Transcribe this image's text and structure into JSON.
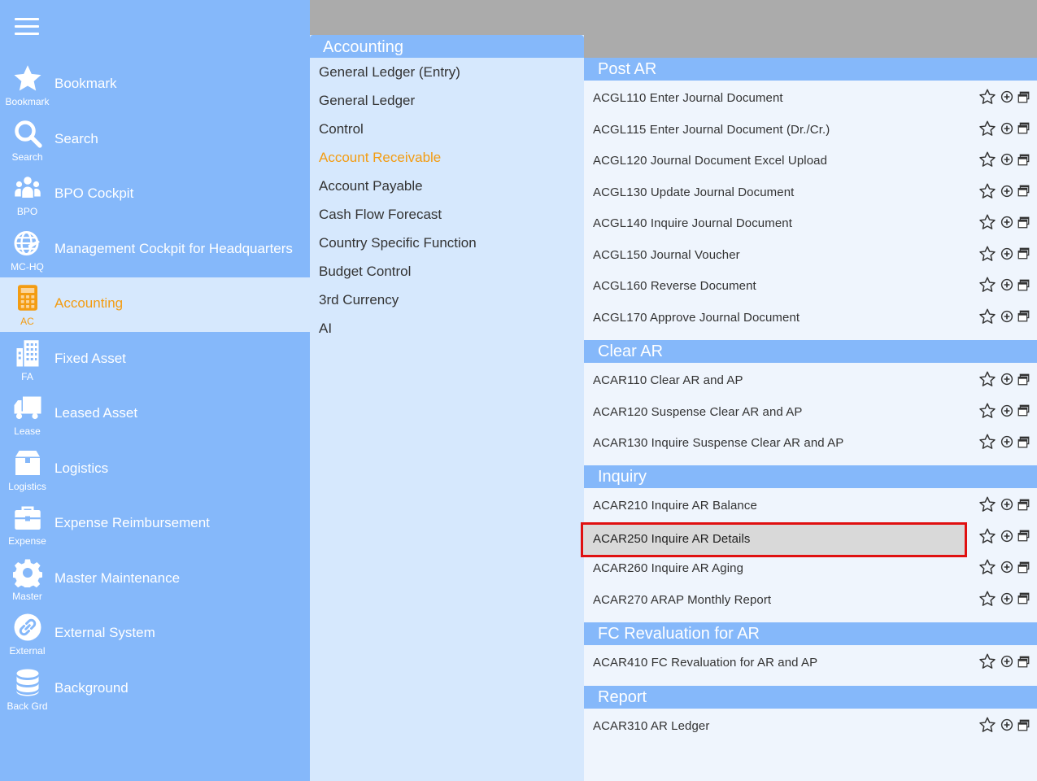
{
  "colors": {
    "sidebar": "#85b8fa",
    "active_bg": "#d6e8fd",
    "active_text": "#f39c12",
    "panel_bg": "#eff5fd",
    "topbar": "#ababab",
    "highlight_border": "#e01010"
  },
  "sidebar": {
    "menu_icon": "hamburger-icon",
    "items": [
      {
        "label": "Bookmark",
        "short": "Bookmark",
        "icon": "star-icon"
      },
      {
        "label": "Search",
        "short": "Search",
        "icon": "search-icon"
      },
      {
        "label": "BPO Cockpit",
        "short": "BPO",
        "icon": "users-icon"
      },
      {
        "label": "Management Cockpit for Headquarters",
        "short": "MC-HQ",
        "icon": "globe-plane-icon"
      },
      {
        "label": "Accounting",
        "short": "AC",
        "icon": "calculator-icon",
        "active": true
      },
      {
        "label": "Fixed Asset",
        "short": "FA",
        "icon": "building-icon"
      },
      {
        "label": "Leased Asset",
        "short": "Lease",
        "icon": "truck-icon"
      },
      {
        "label": "Logistics",
        "short": "Logistics",
        "icon": "box-icon"
      },
      {
        "label": "Expense Reimbursement",
        "short": "Expense",
        "icon": "briefcase-icon"
      },
      {
        "label": "Master Maintenance",
        "short": "Master",
        "icon": "gear-icon"
      },
      {
        "label": "External System",
        "short": "External",
        "icon": "link-icon"
      },
      {
        "label": "Background",
        "short": "Back Grd",
        "icon": "database-icon"
      }
    ]
  },
  "middle": {
    "title": "Accounting",
    "items": [
      {
        "label": "General Ledger (Entry)"
      },
      {
        "label": "General Ledger"
      },
      {
        "label": "Control"
      },
      {
        "label": "Account Receivable",
        "active": true
      },
      {
        "label": "Account Payable"
      },
      {
        "label": "Cash Flow Forecast"
      },
      {
        "label": "Country Specific Function"
      },
      {
        "label": "Budget Control"
      },
      {
        "label": "3rd Currency"
      },
      {
        "label": "AI"
      }
    ]
  },
  "sections": [
    {
      "title": "Post AR",
      "rows": [
        "ACGL110 Enter Journal Document",
        "ACGL115 Enter Journal Document (Dr./Cr.)",
        "ACGL120 Journal Document Excel Upload",
        "ACGL130 Update Journal Document",
        "ACGL140 Inquire Journal Document",
        "ACGL150 Journal Voucher",
        "ACGL160 Reverse Document",
        "ACGL170 Approve Journal Document"
      ]
    },
    {
      "title": "Clear AR",
      "rows": [
        "ACAR110 Clear AR and AP",
        "ACAR120 Suspense Clear AR and AP",
        "ACAR130 Inquire Suspense Clear AR and AP"
      ]
    },
    {
      "title": "Inquiry",
      "rows": [
        "ACAR210 Inquire AR Balance",
        "ACAR250 Inquire AR Details",
        "ACAR260 Inquire AR Aging",
        "ACAR270 ARAP Monthly Report"
      ]
    },
    {
      "title": "FC Revaluation for AR",
      "rows": [
        "ACAR410 FC Revaluation for AR and AP"
      ]
    },
    {
      "title": "Report",
      "rows": [
        "ACAR310 AR Ledger"
      ]
    }
  ],
  "highlighted_row": "ACAR250 Inquire AR Details",
  "row_action_icons": [
    "star-icon",
    "add-circle-icon",
    "new-window-icon"
  ]
}
